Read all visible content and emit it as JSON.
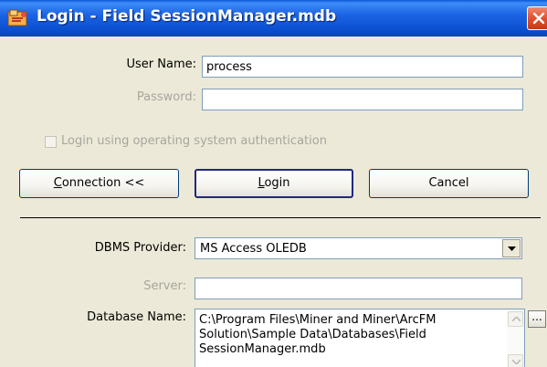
{
  "window": {
    "title": "Login - Field SessionManager.mdb",
    "close_icon": "close-icon",
    "app_icon": "app-icon"
  },
  "form": {
    "user_name_label": "User Name:",
    "user_name_value": "process",
    "password_label": "Password:",
    "password_value": "",
    "os_auth_label": "Login using operating system authentication",
    "os_auth_checked": false
  },
  "buttons": {
    "connection": "Connection <<",
    "login": "Login",
    "cancel": "Cancel"
  },
  "connection": {
    "dbms_provider_label": "DBMS Provider:",
    "dbms_provider_value": "MS Access OLEDB",
    "server_label": "Server:",
    "server_value": "",
    "database_name_label": "Database Name:",
    "database_name_value": "C:\\Program Files\\Miner and Miner\\ArcFM Solution\\Sample Data\\Databases\\Field SessionManager.mdb",
    "browse_label": "..."
  },
  "colors": {
    "titlebar": "#0b50d0",
    "dialog_bg": "#ece9d8",
    "disabled_text": "#a7a69d",
    "field_border": "#7f9db9",
    "close_red": "#e0512f"
  }
}
